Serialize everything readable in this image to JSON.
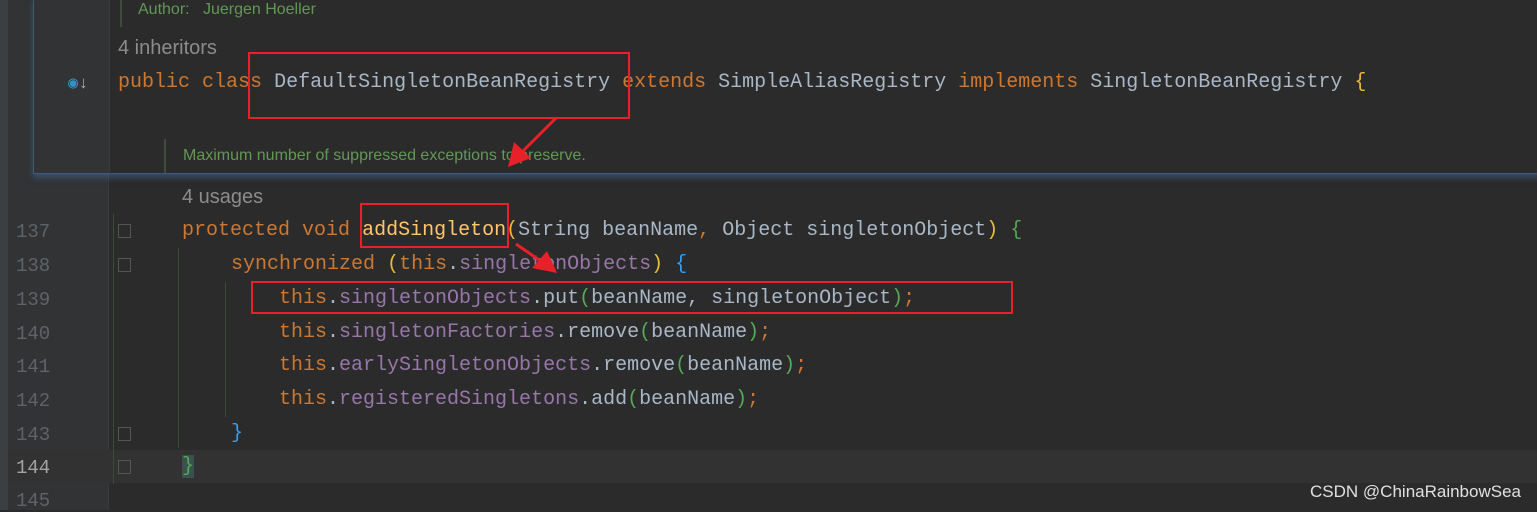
{
  "gutter": {
    "line_numbers": [
      "137",
      "138",
      "139",
      "140",
      "141",
      "142",
      "143",
      "144",
      "145"
    ],
    "current_line": "144"
  },
  "popup": {
    "author_label": "Author:",
    "author_name": "Juergen Hoeller",
    "inheritors_hint": "4 inheritors",
    "class_decl": {
      "public": "public",
      "class": "class",
      "name": "DefaultSingletonBeanRegistry",
      "extends": "extends",
      "super": "SimpleAliasRegistry",
      "implements": "implements",
      "iface": "SingletonBeanRegistry",
      "brace": "{"
    },
    "doc_comment": "Maximum number of suppressed exceptions to preserve.",
    "gutter_icon": "implemented-override-icon"
  },
  "editor": {
    "usages_hint": "4 usages",
    "lines": {
      "l137": {
        "mod": "protected",
        "void": "void",
        "name": "addSingleton",
        "open": "(",
        "type1": "String",
        "p1": "beanName",
        "comma": ",",
        "type2": "Object",
        "p2": "singletonObject",
        "close": ")",
        "brace": "{"
      },
      "l138": {
        "kw": "synchronized",
        "open": "(",
        "this": "this",
        "dot": ".",
        "field": "singletonObjects",
        "close": ")",
        "brace": "{"
      },
      "l139": {
        "this": "this",
        "dot": ".",
        "field": "singletonObjects",
        "call": ".put",
        "open": "(",
        "args": "beanName, singletonObject",
        "close": ")",
        "semi": ";"
      },
      "l140": {
        "this": "this",
        "dot": ".",
        "field": "singletonFactories",
        "call": ".remove",
        "open": "(",
        "args": "beanName",
        "close": ")",
        "semi": ";"
      },
      "l141": {
        "this": "this",
        "dot": ".",
        "field": "earlySingletonObjects",
        "call": ".remove",
        "open": "(",
        "args": "beanName",
        "close": ")",
        "semi": ";"
      },
      "l142": {
        "this": "this",
        "dot": ".",
        "field": "registeredSingletons",
        "call": ".add",
        "open": "(",
        "args": "beanName",
        "close": ")",
        "semi": ";"
      },
      "l143": {
        "brace": "}"
      },
      "l144": {
        "brace": "}"
      }
    }
  },
  "watermark": "CSDN @ChinaRainbowSea",
  "colors": {
    "keyword": "#cc7832",
    "field": "#9876aa",
    "method": "#ffc66d",
    "comment": "#629755",
    "annotation_red": "#e8202a"
  }
}
